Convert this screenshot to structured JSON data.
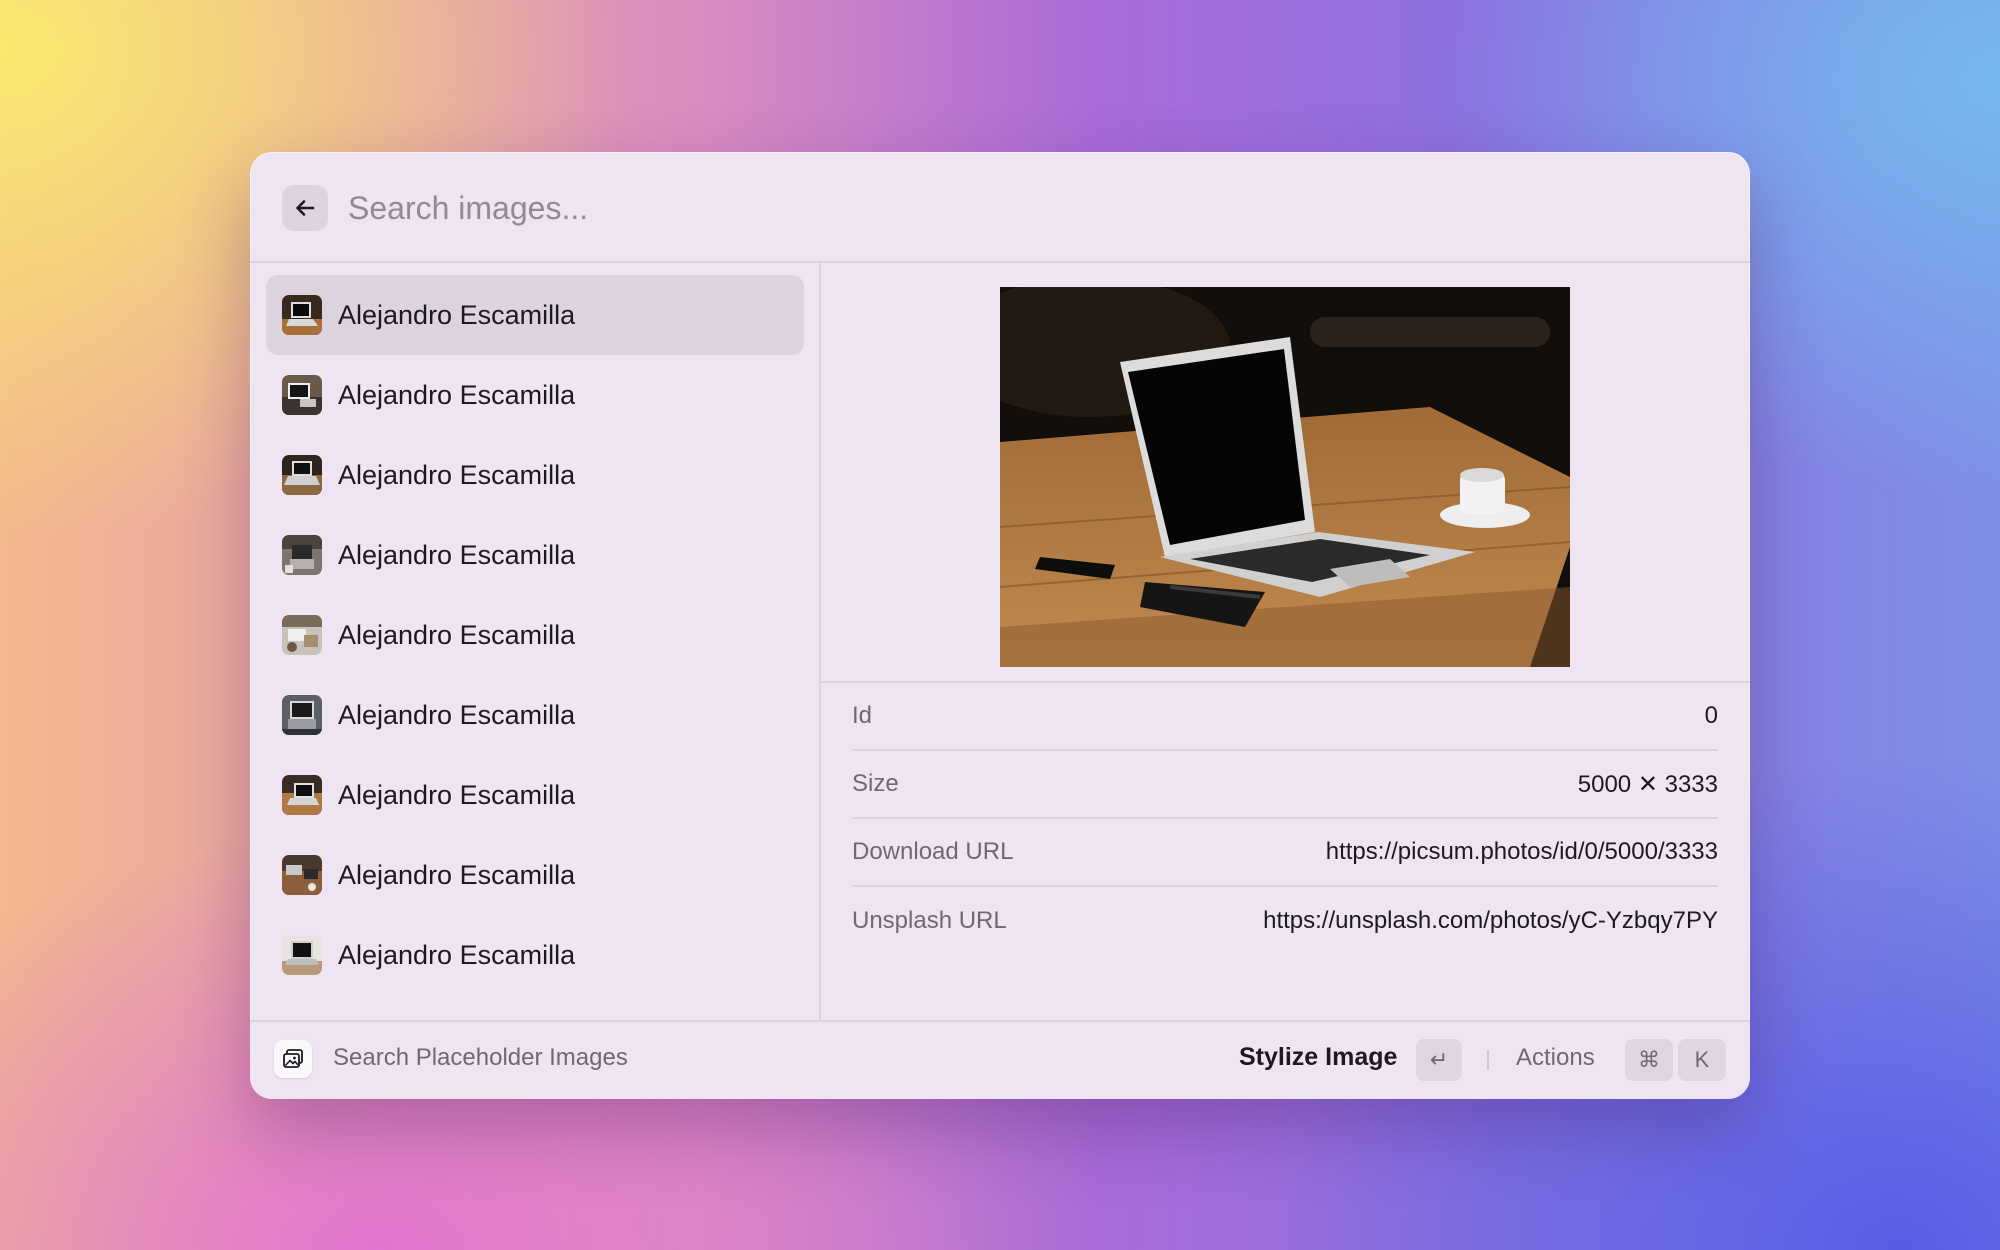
{
  "search": {
    "placeholder": "Search images..."
  },
  "list": {
    "items": [
      {
        "label": "Alejandro Escamilla",
        "selected": true
      },
      {
        "label": "Alejandro Escamilla"
      },
      {
        "label": "Alejandro Escamilla"
      },
      {
        "label": "Alejandro Escamilla"
      },
      {
        "label": "Alejandro Escamilla"
      },
      {
        "label": "Alejandro Escamilla"
      },
      {
        "label": "Alejandro Escamilla"
      },
      {
        "label": "Alejandro Escamilla"
      },
      {
        "label": "Alejandro Escamilla"
      }
    ]
  },
  "detail": {
    "metadata": [
      {
        "label": "Id",
        "value": "0"
      },
      {
        "label": "Size",
        "value": "5000 ✕ 3333"
      },
      {
        "label": "Download URL",
        "value": "https://picsum.photos/id/0/5000/3333"
      },
      {
        "label": "Unsplash URL",
        "value": "https://unsplash.com/photos/yC-Yzbqy7PY"
      }
    ]
  },
  "footer": {
    "extension_name": "Search Placeholder Images",
    "primary_action": "Stylize Image",
    "enter_key": "↵",
    "actions_label": "Actions",
    "cmd_key": "⌘",
    "k_key": "K"
  },
  "icons": {
    "back": "arrow-left-icon",
    "extension": "images-icon"
  }
}
